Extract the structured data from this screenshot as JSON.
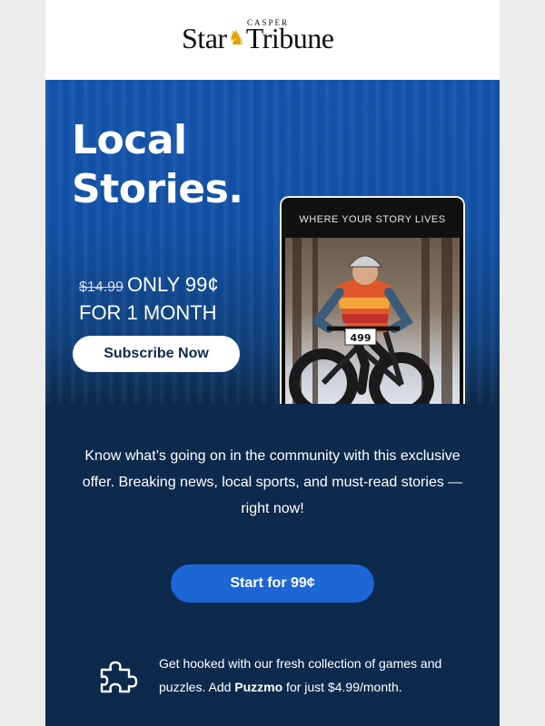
{
  "brand": {
    "logo_small": "CASPER",
    "logo_left": "Star",
    "logo_right": "Tribune",
    "colors": {
      "masthead_bg": "#ffffff",
      "email_bg": "#0d2a4d",
      "hero_blue": "#1455b0",
      "accent_button": "#1c66d6",
      "logo_horse": "#e0a100"
    }
  },
  "hero": {
    "headline": "Local Stories.",
    "old_price": "$14.99",
    "offer_line1": "ONLY 99¢",
    "offer_line2": "FOR 1 MONTH",
    "subscribe_label": "Subscribe Now",
    "phone_header": "WHERE YOUR STORY LIVES",
    "bib_number": "499"
  },
  "body": {
    "description": "Know what’s going on in the community with this exclusive offer. Breaking news, local sports, and must-read stories — right now!",
    "start_label": "Start for 99¢"
  },
  "puzzmo": {
    "icon": "puzzle-icon",
    "text_before": "Get hooked with our fresh collection of games and puzzles. Add ",
    "brand": "Puzzmo",
    "text_after": " for just $4.99/month."
  }
}
